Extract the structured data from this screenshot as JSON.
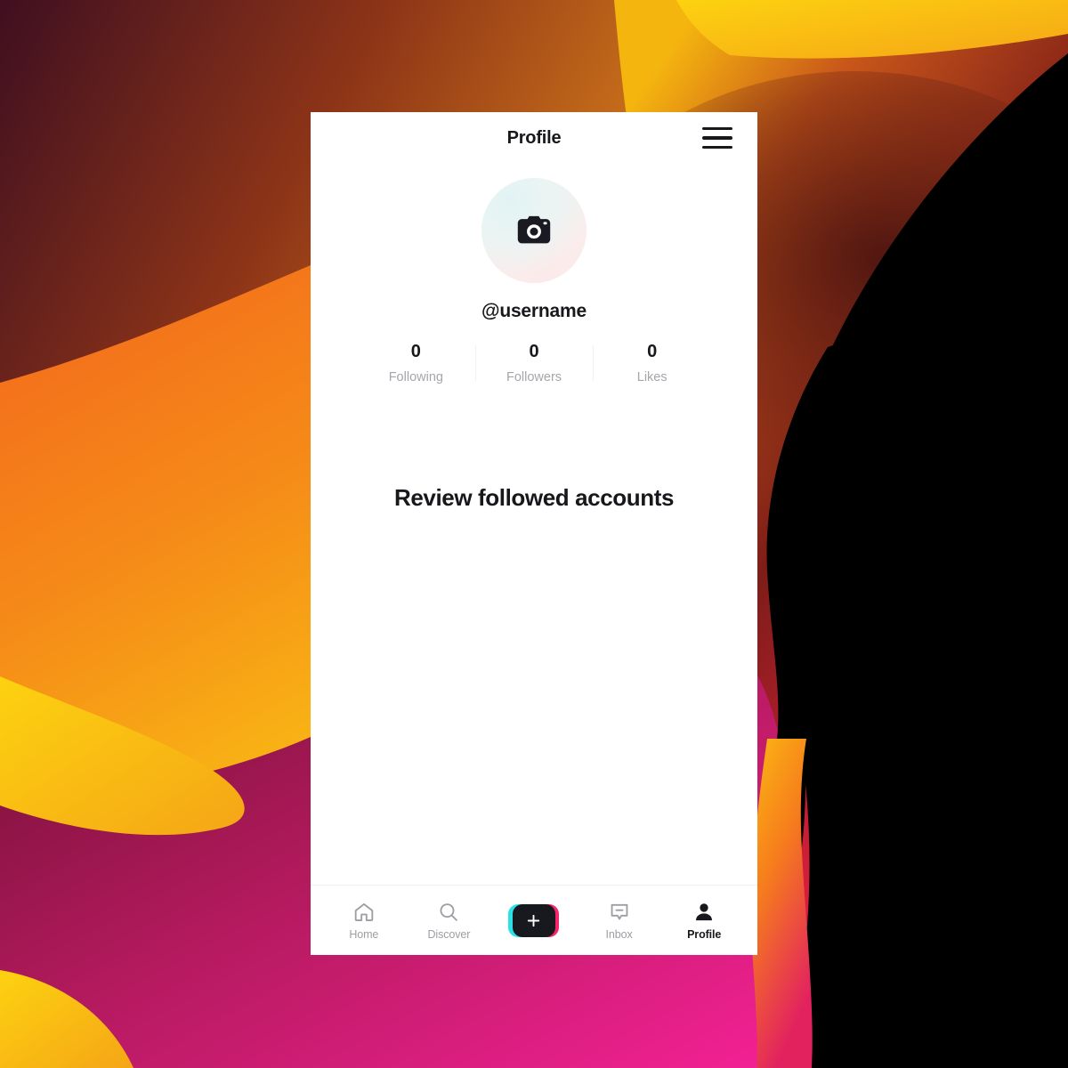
{
  "header": {
    "title": "Profile",
    "menu_icon": "hamburger-menu-icon"
  },
  "profile": {
    "avatar_icon": "camera-icon",
    "username": "@username",
    "stats": [
      {
        "value": "0",
        "label": "Following"
      },
      {
        "value": "0",
        "label": "Followers"
      },
      {
        "value": "0",
        "label": "Likes"
      }
    ]
  },
  "content": {
    "heading": "Review followed accounts"
  },
  "bottom_nav": {
    "items": [
      {
        "label": "Home",
        "icon": "home-icon",
        "active": false
      },
      {
        "label": "Discover",
        "icon": "search-icon",
        "active": false
      },
      {
        "label": "Inbox",
        "icon": "inbox-icon",
        "active": false
      },
      {
        "label": "Profile",
        "icon": "person-icon",
        "active": true
      }
    ],
    "create_button": {
      "icon": "plus-icon",
      "color_left": "#2ce0e8",
      "color_right": "#f6266a",
      "color_center": "#18181f"
    }
  },
  "theme": {
    "text_primary": "#17181b",
    "text_muted": "#a5a6ab",
    "card_background": "#ffffff",
    "divider": "#f0f0f1"
  },
  "wallpaper": {
    "description": "abstract-flowing-gradient",
    "colors": [
      "#f5b612",
      "#f07d1c",
      "#e0432f",
      "#f01c52",
      "#c41765",
      "#7d1338",
      "#3d0a1e",
      "#000000"
    ]
  }
}
